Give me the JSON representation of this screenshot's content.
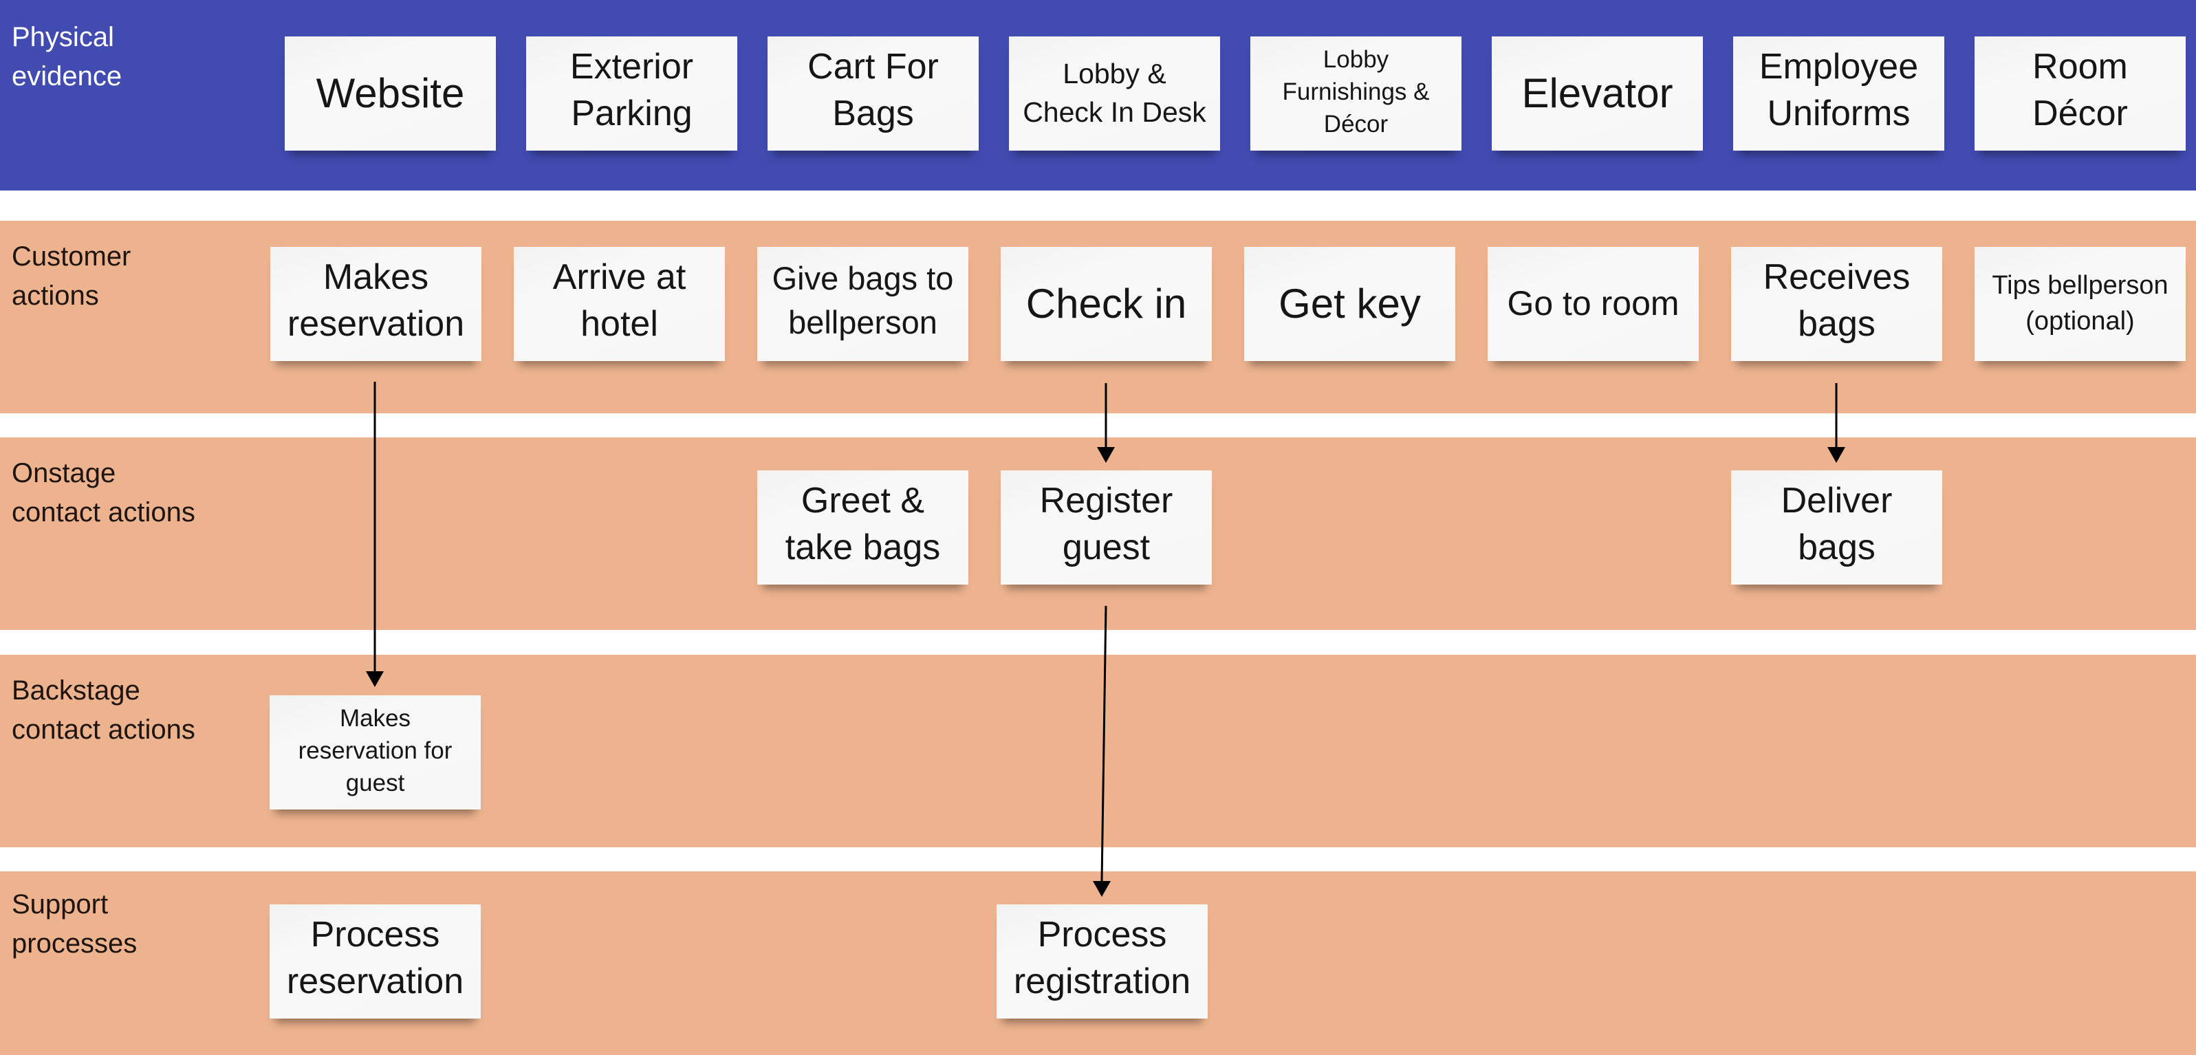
{
  "colors": {
    "physical_evidence_band": "#414BB0",
    "action_band": "#EDB38F",
    "note": "#F7F7F7",
    "arrow": "#000000"
  },
  "lanes": [
    {
      "id": "physical-evidence",
      "label": "Physical\nevidence",
      "notes": [
        {
          "text": "Website"
        },
        {
          "text": "Exterior\nParking"
        },
        {
          "text": "Cart For\nBags"
        },
        {
          "text": "Lobby &\nCheck In Desk"
        },
        {
          "text": "Lobby\nFurnishings &\nDécor"
        },
        {
          "text": "Elevator"
        },
        {
          "text": "Employee\nUniforms"
        },
        {
          "text": "Room\nDécor"
        }
      ]
    },
    {
      "id": "customer-actions",
      "label": "Customer\nactions",
      "notes": [
        {
          "text": "Makes\nreservation"
        },
        {
          "text": "Arrive at\nhotel"
        },
        {
          "text": "Give bags to\nbellperson"
        },
        {
          "text": "Check in"
        },
        {
          "text": "Get key"
        },
        {
          "text": "Go to room"
        },
        {
          "text": "Receives\nbags"
        },
        {
          "text": "Tips bellperson\n(optional)"
        }
      ]
    },
    {
      "id": "onstage-contact-actions",
      "label": "Onstage\ncontact actions",
      "notes": [
        {
          "text": "Greet &\ntake bags"
        },
        {
          "text": "Register\nguest"
        },
        {
          "text": "Deliver\nbags"
        }
      ]
    },
    {
      "id": "backstage-contact-actions",
      "label": "Backstage\ncontact actions",
      "notes": [
        {
          "text": "Makes\nreservation for\nguest"
        }
      ]
    },
    {
      "id": "support-processes",
      "label": "Support\nprocesses",
      "notes": [
        {
          "text": "Process\nreservation"
        },
        {
          "text": "Process\nregistration"
        }
      ]
    }
  ],
  "connections": [
    {
      "from": "Makes reservation",
      "to": "Makes reservation for guest"
    },
    {
      "from": "Check in",
      "to": "Register guest"
    },
    {
      "from": "Receives bags",
      "to": "Deliver bags"
    },
    {
      "from": "Register guest",
      "to": "Process registration"
    }
  ]
}
